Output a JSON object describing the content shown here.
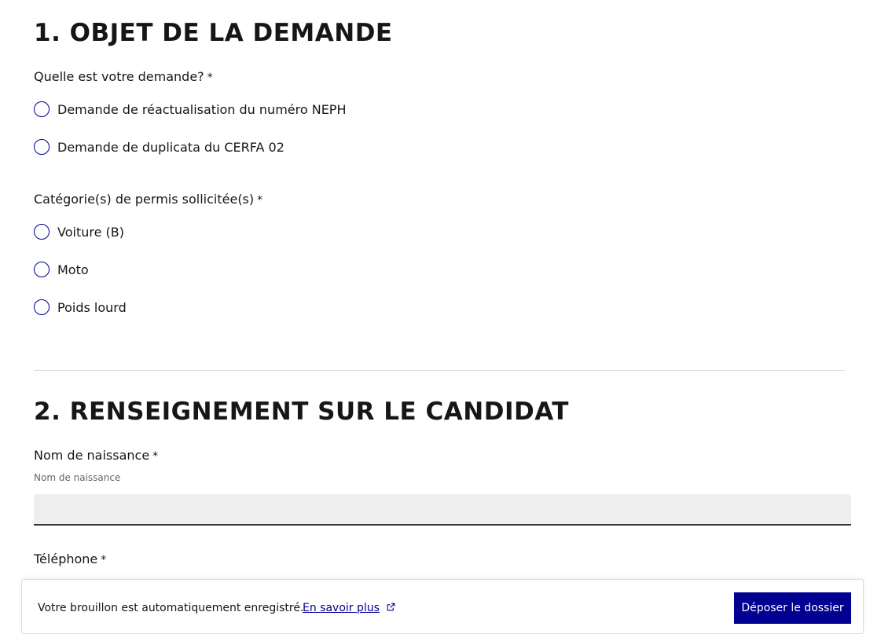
{
  "section1": {
    "title": "1. OBJET DE LA DEMANDE",
    "question1": {
      "label": "Quelle est votre demande?",
      "required_mark": "*",
      "options": [
        "Demande de réactualisation du numéro NEPH",
        "Demande de duplicata du CERFA 02"
      ]
    },
    "question2": {
      "label": "Catégorie(s) de permis sollicitée(s)",
      "required_mark": "*",
      "options": [
        "Voiture (B)",
        "Moto",
        "Poids lourd"
      ]
    }
  },
  "section2": {
    "title": "2. RENSEIGNEMENT SUR LE CANDIDAT",
    "nom_naissance": {
      "label": "Nom de naissance",
      "required_mark": "*",
      "hint": "Nom de naissance",
      "value": ""
    },
    "telephone": {
      "label": "Téléphone",
      "required_mark": "*"
    }
  },
  "footer": {
    "autosave_text": "Votre brouillon est automatiquement enregistré.",
    "learn_more_link": "En savoir plus",
    "submit_label": "Déposer le dossier"
  },
  "colors": {
    "primary_blue": "#000091",
    "text": "#161616",
    "input_bg": "#eeeeee"
  },
  "icons": {
    "external_link": "external-link-icon"
  }
}
